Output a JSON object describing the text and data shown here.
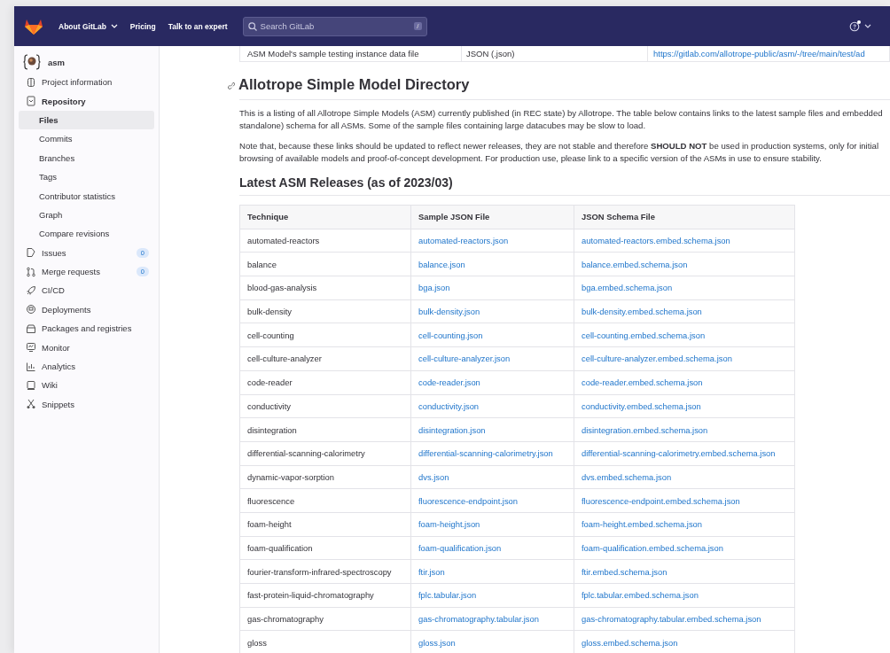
{
  "header": {
    "nav": [
      {
        "label": "About GitLab",
        "dropdown": true
      },
      {
        "label": "Pricing",
        "dropdown": false
      },
      {
        "label": "Talk to an expert",
        "dropdown": false
      }
    ],
    "search": {
      "placeholder": "Search GitLab",
      "shortcut": "/"
    }
  },
  "sidebar": {
    "project": {
      "name": "asm"
    },
    "items": [
      {
        "label": "Project information",
        "selected": false
      },
      {
        "label": "Repository",
        "selected": false,
        "expanded": true,
        "children": [
          {
            "label": "Files",
            "selected": true
          },
          {
            "label": "Commits",
            "selected": false
          },
          {
            "label": "Branches",
            "selected": false
          },
          {
            "label": "Tags",
            "selected": false
          },
          {
            "label": "Contributor statistics",
            "selected": false
          },
          {
            "label": "Graph",
            "selected": false
          },
          {
            "label": "Compare revisions",
            "selected": false
          }
        ]
      },
      {
        "label": "Issues",
        "selected": false,
        "badge": "0"
      },
      {
        "label": "Merge requests",
        "selected": false,
        "badge": "0"
      },
      {
        "label": "CI/CD",
        "selected": false
      },
      {
        "label": "Deployments",
        "selected": false
      },
      {
        "label": "Packages and registries",
        "selected": false
      },
      {
        "label": "Monitor",
        "selected": false
      },
      {
        "label": "Analytics",
        "selected": false
      },
      {
        "label": "Wiki",
        "selected": false
      },
      {
        "label": "Snippets",
        "selected": false
      }
    ]
  },
  "content": {
    "previous_table_row": [
      {
        "text": "ASM Model's sample testing instance data file",
        "link": false
      },
      {
        "text": "JSON (.json)",
        "link": false
      },
      {
        "text": "https://gitlab.com/allotrope-public/asm/-/tree/main/test/ad",
        "link": true
      }
    ],
    "heading": "Allotrope Simple Model Directory",
    "paragraphs": [
      {
        "lines": [
          "This is a listing of all Allotrope Simple Models (ASM) currently published (in REC state) by Allotrope. The table below contains links to the latest sample files and embedded",
          "standalone) schema for all ASMs. Some of the sample files containing large datacubes may be slow to load."
        ]
      },
      {
        "lines": [
          "Note that, because these links should be updated to reflect newer releases, they are not stable and therefore **SHOULD NOT** be used in production systems, only for initial",
          "browsing of available models and proof-of-concept development. For production use, please link to a specific version of the ASMs in use to ensure stability."
        ]
      }
    ],
    "subheading": "Latest ASM Releases (as of 2023/03)",
    "table": {
      "columns": [
        "Technique",
        "Sample JSON File",
        "JSON Schema File"
      ],
      "rows": [
        [
          "automated-reactors",
          "automated-reactors.json",
          "automated-reactors.embed.schema.json"
        ],
        [
          "balance",
          "balance.json",
          "balance.embed.schema.json"
        ],
        [
          "blood-gas-analysis",
          "bga.json",
          "bga.embed.schema.json"
        ],
        [
          "bulk-density",
          "bulk-density.json",
          "bulk-density.embed.schema.json"
        ],
        [
          "cell-counting",
          "cell-counting.json",
          "cell-counting.embed.schema.json"
        ],
        [
          "cell-culture-analyzer",
          "cell-culture-analyzer.json",
          "cell-culture-analyzer.embed.schema.json"
        ],
        [
          "code-reader",
          "code-reader.json",
          "code-reader.embed.schema.json"
        ],
        [
          "conductivity",
          "conductivity.json",
          "conductivity.embed.schema.json"
        ],
        [
          "disintegration",
          "disintegration.json",
          "disintegration.embed.schema.json"
        ],
        [
          "differential-scanning-calorimetry",
          "differential-scanning-calorimetry.json",
          "differential-scanning-calorimetry.embed.schema.json"
        ],
        [
          "dynamic-vapor-sorption",
          "dvs.json",
          "dvs.embed.schema.json"
        ],
        [
          "fluorescence",
          "fluorescence-endpoint.json",
          "fluorescence-endpoint.embed.schema.json"
        ],
        [
          "foam-height",
          "foam-height.json",
          "foam-height.embed.schema.json"
        ],
        [
          "foam-qualification",
          "foam-qualification.json",
          "foam-qualification.embed.schema.json"
        ],
        [
          "fourier-transform-infrared-spectroscopy",
          "ftir.json",
          "ftir.embed.schema.json"
        ],
        [
          "fast-protein-liquid-chromatography",
          "fplc.tabular.json",
          "fplc.tabular.embed.schema.json"
        ],
        [
          "gas-chromatography",
          "gas-chromatography.tabular.json",
          "gas-chromatography.tabular.embed.schema.json"
        ],
        [
          "gloss",
          "gloss.json",
          "gloss.embed.schema.json"
        ]
      ]
    }
  }
}
